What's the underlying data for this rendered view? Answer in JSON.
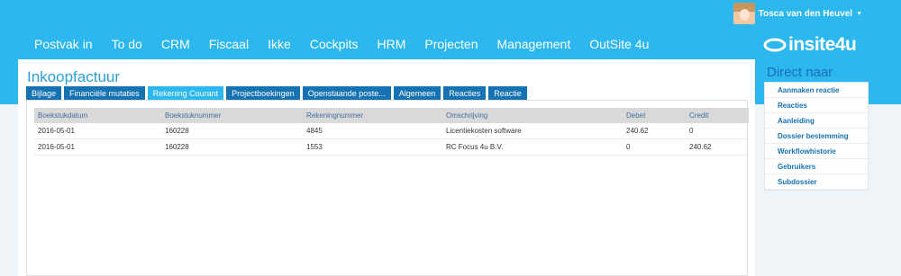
{
  "user": {
    "name": "Tosca van den Heuvel"
  },
  "nav": [
    "Postvak in",
    "To do",
    "CRM",
    "Fiscaal",
    "Ikke",
    "Cockpits",
    "HRM",
    "Projecten",
    "Management",
    "OutSite 4u"
  ],
  "logo": "insite4u",
  "page": {
    "title": "Inkoopfactuur"
  },
  "tabs": [
    "Bijlage",
    "Financiële mutaties",
    "Rekening Courant",
    "Projectboekingen",
    "Openstaande poste...",
    "Algemeen",
    "Reacties",
    "Reactie"
  ],
  "table": {
    "headers": [
      "Boekstukdatum",
      "Boekstuknummer",
      "Rekeningnummer",
      "Omschrijving",
      "Debet",
      "Credit"
    ],
    "rows": [
      [
        "2016-05-01",
        "160228",
        "4845",
        "Licentiekosten software",
        "240.62",
        "0"
      ],
      [
        "2016-05-01",
        "160228",
        "1553",
        "RC Focus 4u B.V.",
        "0",
        "240.62"
      ]
    ]
  },
  "right": {
    "title": "Direct naar",
    "links": [
      "Aanmaken reactie",
      "Reacties",
      "Aanleiding",
      "Dossier bestemming",
      "Workflowhistorie",
      "Gebruikers",
      "Subdossier"
    ]
  },
  "colors": {
    "brand": "#2cb8ee",
    "tab": "#1572b3",
    "title": "#2a9fd6"
  }
}
